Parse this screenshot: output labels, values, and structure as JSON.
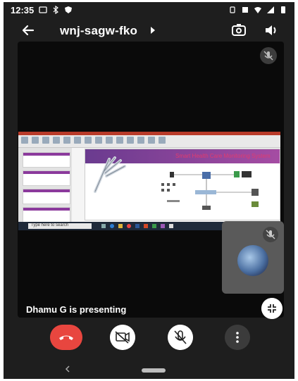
{
  "status_bar": {
    "time": "12:35",
    "icons_left": [
      "cast-icon",
      "bluetooth-icon",
      "shield-icon"
    ],
    "icons_right": [
      "vibrate-icon",
      "sim-card-icon",
      "wifi-icon",
      "signal-icon",
      "battery-icon"
    ]
  },
  "app_bar": {
    "meeting_code": "wnj-sagw-fko"
  },
  "shared_screen": {
    "slide_heading": "Smart Health Care Monitoring System",
    "taskbar_search": "Type here to search"
  },
  "presenter_label": "Dhamu G is presenting",
  "controls": {
    "end_call_color": "#e8463f"
  },
  "colors": {
    "background": "#1e1e1e",
    "stage": "#0a0a0a",
    "accent_red": "#e8463f"
  }
}
